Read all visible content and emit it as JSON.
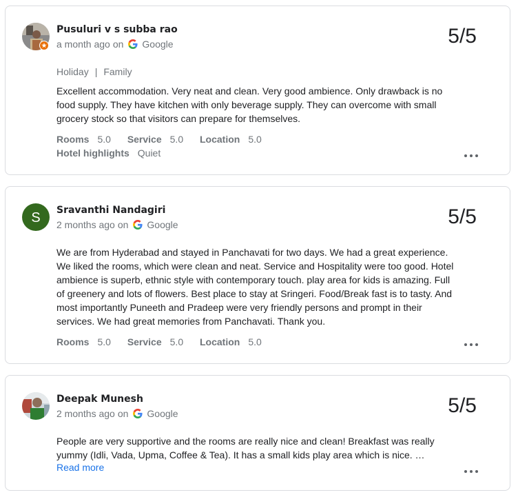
{
  "source_name": "Google",
  "reviews": [
    {
      "author": "Pusuluri v s subba rao",
      "time": "a month ago",
      "on": "on",
      "score": "5/5",
      "trip_type": "Holiday",
      "trip_separator": "|",
      "travel_group": "Family",
      "text": "Excellent accommodation. Very neat and clean. Very good ambience. Only drawback is no food supply. They have kitchen with only beverage supply. They can overcome with small grocery stock so that visitors can prepare for themselves.",
      "ratings": [
        {
          "label": "Rooms",
          "value": "5.0"
        },
        {
          "label": "Service",
          "value": "5.0"
        },
        {
          "label": "Location",
          "value": "5.0"
        }
      ],
      "highlights_label": "Hotel highlights",
      "highlights_value": "Quiet",
      "avatar_icon": "photo-avatar-with-local-guide-badge"
    },
    {
      "author": "Sravanthi Nandagiri",
      "time": "2 months ago",
      "on": "on",
      "score": "5/5",
      "text": "We are from Hyderabad and stayed in Panchavati for two days. We had a great experience. We liked the rooms, which were clean and neat. Service and Hospitality were too good. Hotel ambience is superb, ethnic style with contemporary touch. play area for kids is amazing. Full of greenery and lots of flowers. Best place to stay at Sringeri. Food/Break fast is to tasty. And most importantly Puneeth and Pradeep were very friendly persons and prompt in their services. We had great memories from Panchavati. Thank you.",
      "ratings": [
        {
          "label": "Rooms",
          "value": "5.0"
        },
        {
          "label": "Service",
          "value": "5.0"
        },
        {
          "label": "Location",
          "value": "5.0"
        }
      ],
      "avatar_letter": "S",
      "avatar_color": "#33691e"
    },
    {
      "author": "Deepak Munesh",
      "time": "2 months ago",
      "on": "on",
      "score": "5/5",
      "text": "People are very supportive and the rooms are really nice and clean! Breakfast was really yummy (Idli, Vada, Upma, Coffee & Tea). It has a small kids play area which is nice. …",
      "read_more": "Read more",
      "avatar_icon": "photo-avatar"
    }
  ],
  "colors": {
    "border": "#dadce0",
    "muted_text": "#70757a",
    "link": "#1a73e8",
    "local_guide_badge": "#e8710a"
  }
}
